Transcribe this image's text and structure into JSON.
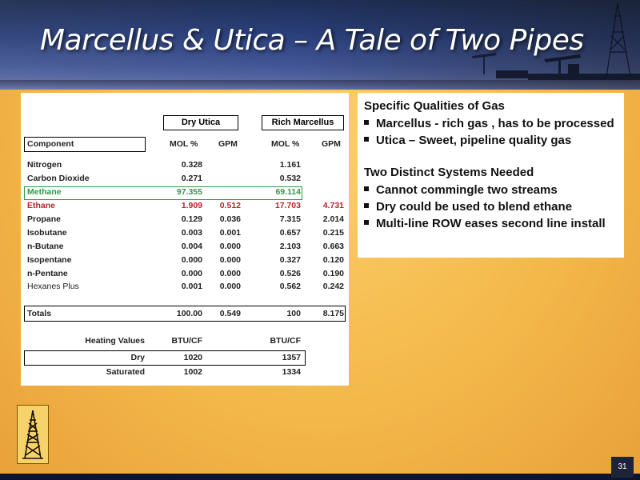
{
  "slide": {
    "title": "Marcellus & Utica – A Tale of Two Pipes",
    "page_number": "31"
  },
  "table": {
    "dry_utica_label": "Dry Utica",
    "rich_marcellus_label": "Rich  Marcellus",
    "col_component": "Component",
    "col_mol1": "MOL %",
    "col_gpm1": "GPM",
    "col_mol2": "MOL %",
    "col_gpm2": "GPM",
    "rows": [
      {
        "name": "Nitrogen",
        "mol1": "0.328",
        "gpm1": "",
        "mol2": "1.161",
        "gpm2": ""
      },
      {
        "name": "Carbon Dioxide",
        "mol1": "0.271",
        "gpm1": "",
        "mol2": "0.532",
        "gpm2": ""
      },
      {
        "name": "Methane",
        "mol1": "97.355",
        "gpm1": "",
        "mol2": "69.114",
        "gpm2": ""
      },
      {
        "name": "Ethane",
        "mol1": "1.909",
        "gpm1": "0.512",
        "mol2": "17.703",
        "gpm2": "4.731"
      },
      {
        "name": "Propane",
        "mol1": "0.129",
        "gpm1": "0.036",
        "mol2": "7.315",
        "gpm2": "2.014"
      },
      {
        "name": "Isobutane",
        "mol1": "0.003",
        "gpm1": "0.001",
        "mol2": "0.657",
        "gpm2": "0.215"
      },
      {
        "name": "n-Butane",
        "mol1": "0.004",
        "gpm1": "0.000",
        "mol2": "2.103",
        "gpm2": "0.663"
      },
      {
        "name": "Isopentane",
        "mol1": "0.000",
        "gpm1": "0.000",
        "mol2": "0.327",
        "gpm2": "0.120"
      },
      {
        "name": "n-Pentane",
        "mol1": "0.000",
        "gpm1": "0.000",
        "mol2": "0.526",
        "gpm2": "0.190"
      },
      {
        "name": "Hexanes Plus",
        "mol1": "0.001",
        "gpm1": "0.000",
        "mol2": "0.562",
        "gpm2": "0.242"
      }
    ],
    "totals": {
      "label": "Totals",
      "mol1": "100.00",
      "gpm1": "0.549",
      "mol2": "100",
      "gpm2": "8.175"
    },
    "heating": {
      "label": "Heating Values",
      "unit1": "BTU/CF",
      "unit2": "BTU/CF",
      "dry_label": "Dry",
      "dry1": "1020",
      "dry2": "1357",
      "sat_label": "Saturated",
      "sat1": "1002",
      "sat2": "1334"
    }
  },
  "qualities": {
    "heading1": "Specific Qualities of  Gas",
    "items1": [
      "Marcellus - rich gas , has to be processed",
      "Utica – Sweet, pipeline quality gas"
    ],
    "heading2": "Two Distinct Systems Needed",
    "items2": [
      "Cannot commingle two streams",
      "Dry could be used to blend ethane",
      "Multi-line ROW eases second line install"
    ]
  },
  "colors": {
    "methane": "#2e9a45",
    "ethane": "#b5262b",
    "background": "#f4b84a",
    "header_band": "#1d3370"
  },
  "icons": [
    "oil-derrick-icon",
    "pump-jack-icon",
    "company-logo-derrick-icon"
  ]
}
